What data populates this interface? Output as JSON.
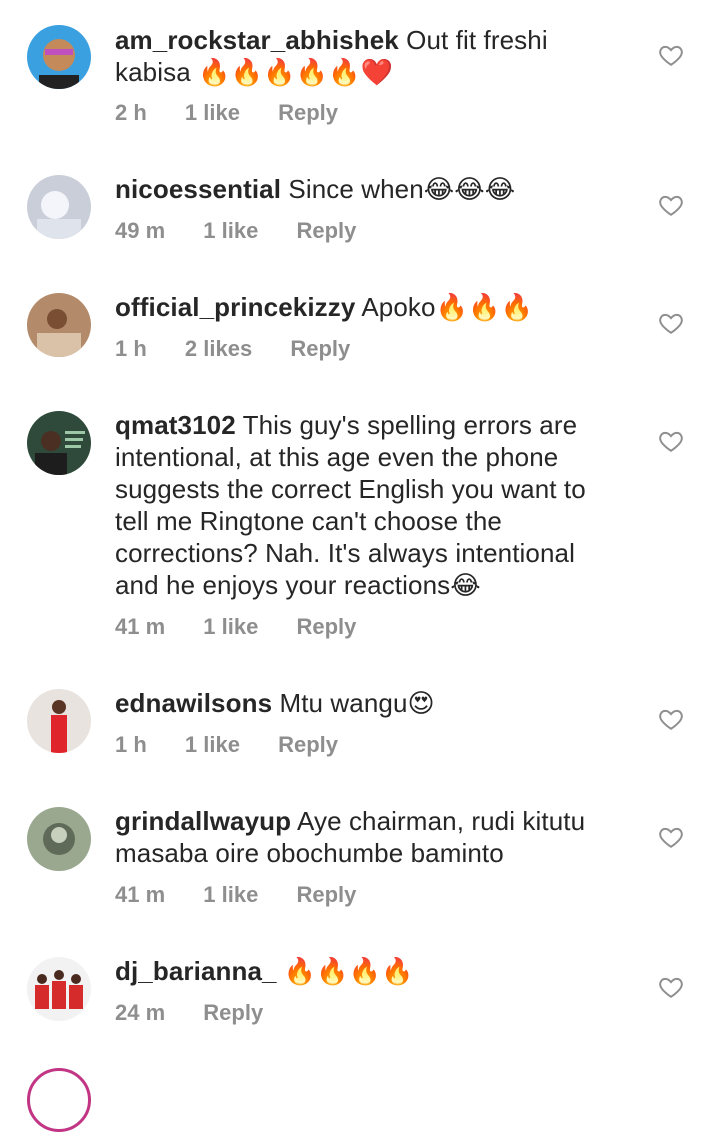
{
  "comments": [
    {
      "username": "am_rockstar_abhishek",
      "text": "Out fit freshi kabisa 🔥🔥🔥🔥🔥❤️",
      "time": "2 h",
      "likes": "1 like",
      "reply": "Reply",
      "avatar_color": "#3aa0e0"
    },
    {
      "username": "nicoessential",
      "text": "Since when😂😂😂",
      "time": "49 m",
      "likes": "1 like",
      "reply": "Reply",
      "avatar_color": "#c9ced9"
    },
    {
      "username": "official_princekizzy",
      "text": "Apoko🔥🔥🔥",
      "time": "1 h",
      "likes": "2 likes",
      "reply": "Reply",
      "avatar_color": "#b38a6a"
    },
    {
      "username": "qmat3102",
      "text": "This guy's spelling errors are intentional, at this age even the phone suggests the correct English you want to tell me Ringtone can't choose the corrections? Nah. It's always intentional and he enjoys your reactions😂",
      "time": "41 m",
      "likes": "1 like",
      "reply": "Reply",
      "avatar_color": "#2f4a3a"
    },
    {
      "username": "ednawilsons",
      "text": "Mtu wangu😍",
      "time": "1 h",
      "likes": "1 like",
      "reply": "Reply",
      "avatar_color": "#e8e3de"
    },
    {
      "username": "grindallwayup",
      "text": "Aye chairman, rudi kitutu masaba oire obochumbe baminto",
      "time": "41 m",
      "likes": "1 like",
      "reply": "Reply",
      "avatar_color": "#9aa88f"
    },
    {
      "username": "dj_barianna_",
      "text": "🔥🔥🔥🔥",
      "time": "24 m",
      "likes": "",
      "reply": "Reply",
      "avatar_color": "#f2f2f2"
    }
  ],
  "icons": {
    "like": "heart-outline-icon"
  }
}
